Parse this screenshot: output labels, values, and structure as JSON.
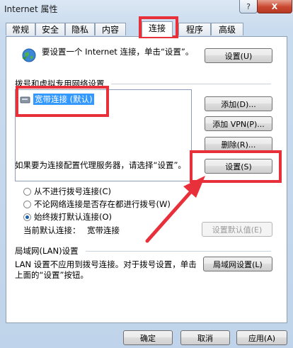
{
  "window": {
    "title": "Internet 属性",
    "help": "?",
    "close": "X"
  },
  "tabs": [
    {
      "label": "常规"
    },
    {
      "label": "安全"
    },
    {
      "label": "隐私"
    },
    {
      "label": "内容"
    },
    {
      "label": "连接"
    },
    {
      "label": "程序"
    },
    {
      "label": "高级"
    }
  ],
  "setup": {
    "text": "要设置一个 Internet 连接，单击“设置”。",
    "button": "设置(U)"
  },
  "dialup": {
    "section_title": "拨号和虚拟专用网络设置",
    "items": [
      "宽带连接 (默认)"
    ],
    "add_button": "添加(D)...",
    "add_vpn_button": "添加 VPN(P)...",
    "delete_button": "删除(R)...",
    "proxy_text": "如果要为连接配置代理服务器，请选择“设置”。",
    "settings_button": "设置(S)",
    "options": [
      {
        "label": "从不进行拨号连接(C)",
        "checked": false
      },
      {
        "label": "不论网络连接是否存在都进行拨号(W)",
        "checked": false
      },
      {
        "label": "始终拨打默认连接(O)",
        "checked": true
      }
    ],
    "current_default_label": "当前默认连接：",
    "current_default_value": "宽带连接",
    "set_default_button": "设置默认值(E)"
  },
  "lan": {
    "section_title": "局域网(LAN)设置",
    "text": "LAN 设置不应用到拨号连接。对于拨号设置，单击上面的“设置”按钮。",
    "button": "局域网设置(L)"
  },
  "footer": {
    "ok": "确定",
    "cancel": "取消",
    "apply": "应用(A)"
  },
  "annotation": {
    "color": "#e8303a"
  }
}
